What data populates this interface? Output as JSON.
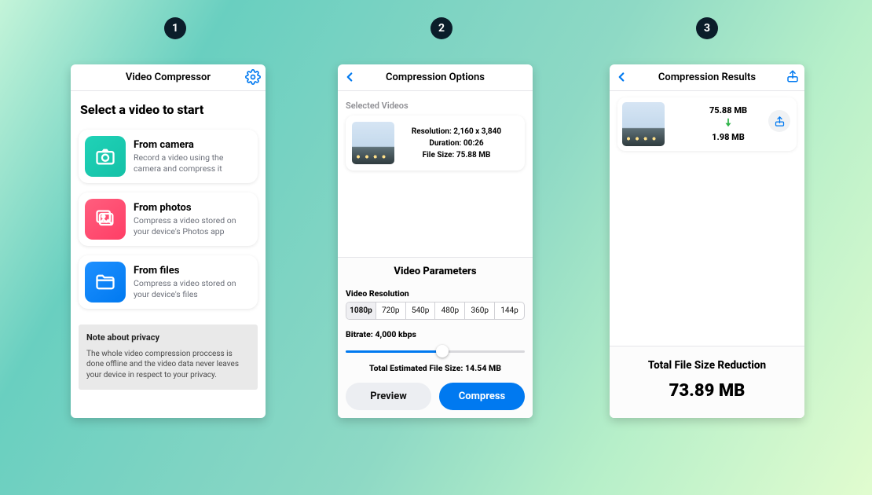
{
  "steps": [
    "1",
    "2",
    "3"
  ],
  "screen1": {
    "title": "Video Compressor",
    "heading": "Select a video to start",
    "options": [
      {
        "title": "From camera",
        "desc": "Record a video using the camera and compress it"
      },
      {
        "title": "From photos",
        "desc": "Compress a video stored on your device's Photos app"
      },
      {
        "title": "From files",
        "desc": "Compress a video stored on your device's files"
      }
    ],
    "note_title": "Note about privacy",
    "note_body": "The whole video compression proccess is done offline and the video data never leaves your device in respect to your privacy."
  },
  "screen2": {
    "title": "Compression Options",
    "section_label": "Selected Videos",
    "meta": {
      "resolution_label": "Resolution:",
      "resolution_value": "2,160 x 3,840",
      "duration_label": "Duration:",
      "duration_value": "00:26",
      "filesize_label": "File Size:",
      "filesize_value": "75.88 MB"
    },
    "panel_title": "Video Parameters",
    "resolution_label": "Video Resolution",
    "resolutions": [
      "1080p",
      "720p",
      "540p",
      "480p",
      "360p",
      "144p"
    ],
    "selected_resolution": "1080p",
    "bitrate_label": "Bitrate: 4,000 kbps",
    "estimate_label": "Total Estimated File Size: 14.54 MB",
    "preview_button": "Preview",
    "compress_button": "Compress"
  },
  "screen3": {
    "title": "Compression Results",
    "before_size": "75.88 MB",
    "after_size": "1.98 MB",
    "summary_label": "Total File Size Reduction",
    "summary_value": "73.89 MB"
  }
}
